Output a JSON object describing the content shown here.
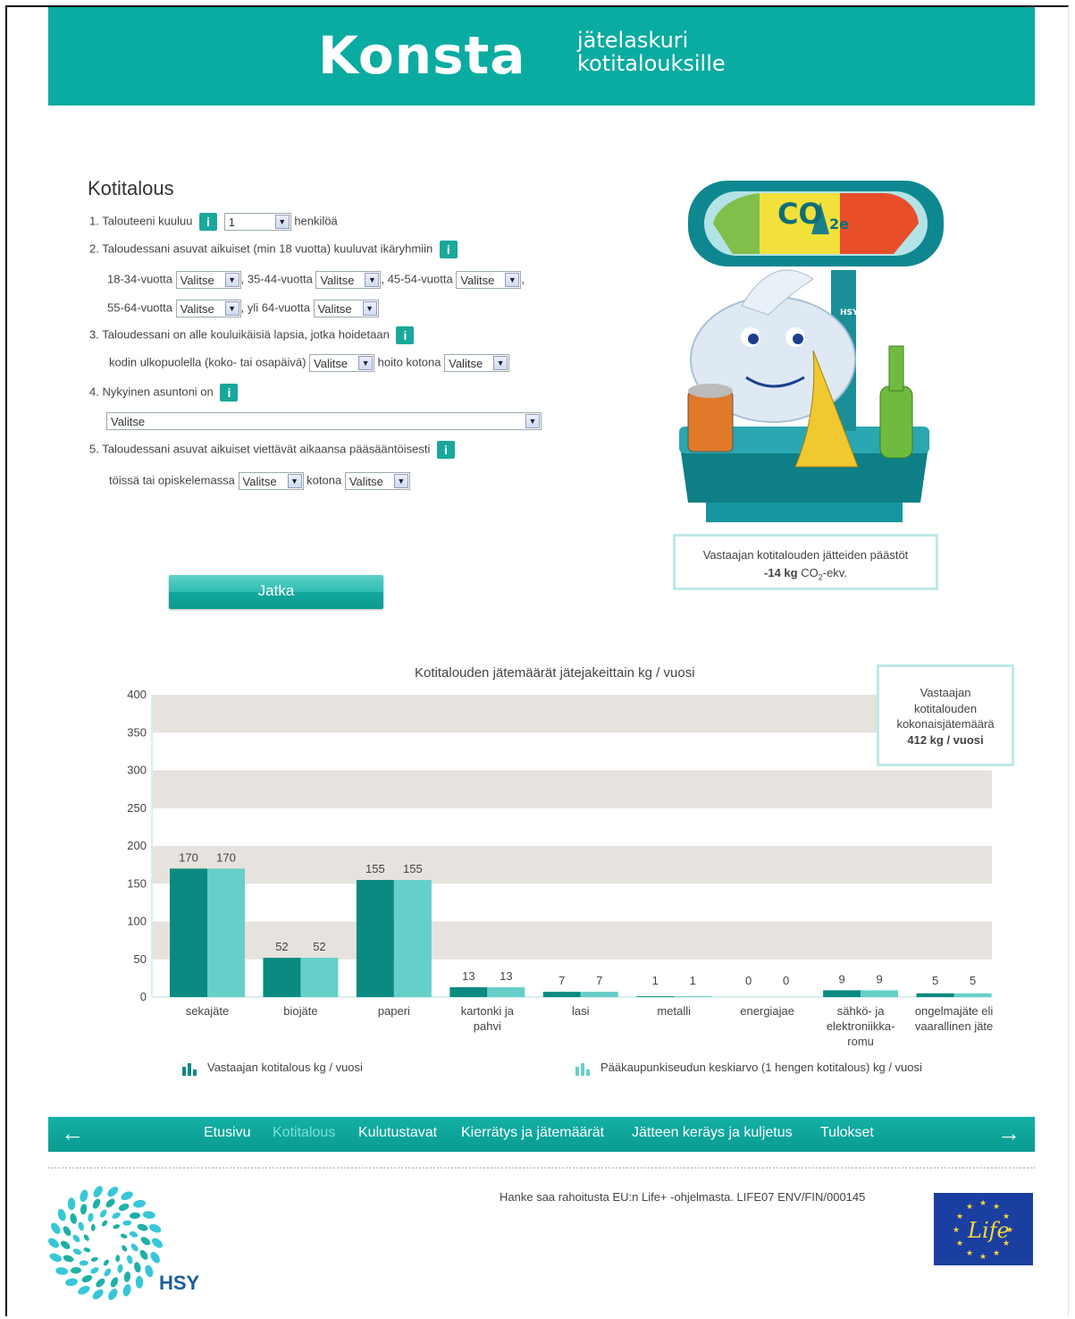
{
  "header": {
    "logo": "Konsta",
    "tagline_line1": "jätelaskuri",
    "tagline_line2": "kotitalouksille"
  },
  "form": {
    "title": "Kotitalous",
    "q1": {
      "num": "1.",
      "text": "Talouteeni kuuluu",
      "value": "1",
      "suffix": "henkilöä"
    },
    "q2": {
      "num": "2.",
      "text": "Taloudessani asuvat aikuiset (min 18 vuotta) kuuluvat ikäryhmiin",
      "g1": "18-34-vuotta",
      "g2": ", 35-44-vuotta",
      "g3": ", 45-54-vuotta",
      "g4": "55-64-vuotta",
      "g5": ", yli 64-vuotta",
      "comma": ","
    },
    "q3": {
      "num": "3.",
      "text": "Taloudessani on alle kouluikäisiä lapsia, jotka hoidetaan",
      "line2a": "kodin ulkopuolella (koko- tai osapäivä)",
      "line2b": "hoito kotona"
    },
    "q4": {
      "num": "4.",
      "text": "Nykyinen asuntoni on"
    },
    "q5": {
      "num": "5.",
      "text": "Taloudessani asuvat aikuiset viettävät aikaansa pääsääntöisesti",
      "line2a": "töissä tai opiskelemassa",
      "line2b": "kotona"
    },
    "select_default": "Valitse",
    "info_glyph": "i",
    "submit": "Jatka"
  },
  "emissions": {
    "label": "Vastaajan kotitalouden jätteiden päästöt",
    "value": "-14 kg",
    "unit_pre": "CO",
    "unit_sub": "2",
    "unit_post": "-ekv."
  },
  "illustration": {
    "meter_label": "CO",
    "meter_sub": "2e",
    "brand": "HSY"
  },
  "total": {
    "line1": "Vastaajan",
    "line2": "kotitalouden",
    "line3": "kokonaisjätemäärä",
    "value": "412 kg / vuosi"
  },
  "chart_data": {
    "type": "bar",
    "title": "Kotitalouden jätemäärät jätejakeittain kg / vuosi",
    "ylim": [
      0,
      400
    ],
    "yticks": [
      0,
      50,
      100,
      150,
      200,
      250,
      300,
      350,
      400
    ],
    "categories": [
      "sekajäte",
      "biojäte",
      "paperi",
      "kartonki ja pahvi",
      "lasi",
      "metalli",
      "energiajae",
      "sähkö- ja elektroniikka-romu",
      "ongelmajäte eli vaarallinen jäte"
    ],
    "category_lines": [
      [
        "sekajäte"
      ],
      [
        "biojäte"
      ],
      [
        "paperi"
      ],
      [
        "kartonki ja",
        "pahvi"
      ],
      [
        "lasi"
      ],
      [
        "metalli"
      ],
      [
        "energiajae"
      ],
      [
        "sähkö- ja",
        "elektroniikka-",
        "romu"
      ],
      [
        "ongelmajäte eli",
        "vaarallinen jäte"
      ]
    ],
    "series": [
      {
        "name": "Vastaajan kotitalous kg / vuosi",
        "color": "#0a8a80",
        "values": [
          170,
          52,
          155,
          13,
          7,
          1,
          0,
          9,
          5
        ]
      },
      {
        "name": "Pääkaupunkiseudun keskiarvo (1 hengen kotitalous) kg / vuosi",
        "color": "#66cfc9",
        "values": [
          170,
          52,
          155,
          13,
          7,
          1,
          0,
          9,
          5
        ]
      }
    ],
    "grid": "alternating-bands",
    "legend": "bottom"
  },
  "nav": {
    "items": [
      "Etusivu",
      "Kotitalous",
      "Kulutustavat",
      "Kierrätys ja jätemäärät",
      "Jätteen keräys ja kuljetus",
      "Tulokset"
    ],
    "active_index": 1,
    "prev_glyph": "←",
    "next_glyph": "→"
  },
  "footer": {
    "funding": "Hanke saa rahoitusta EU:n Life+ -ohjelmasta. LIFE07 ENV/FIN/000145",
    "hsy": "HSY",
    "life": "Life"
  }
}
